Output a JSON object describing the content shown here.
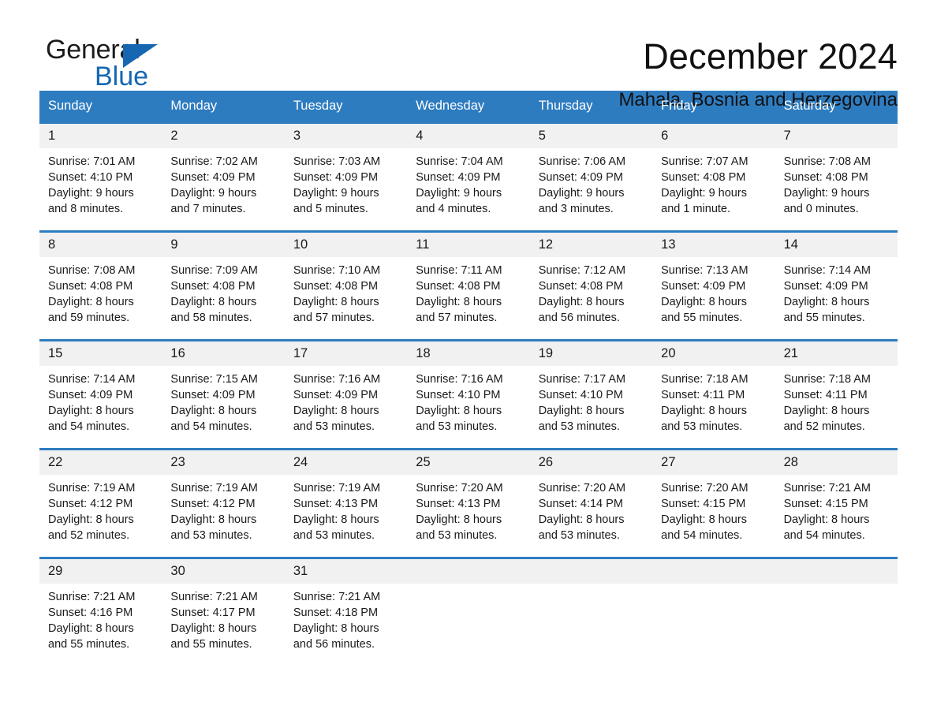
{
  "brand": {
    "name_part1": "General",
    "name_part2": "Blue",
    "triangle_icon": "blue-triangle-icon",
    "accent_color": "#1667b2"
  },
  "header": {
    "title": "December 2024",
    "location": "Mahala, Bosnia and Herzegovina"
  },
  "calendar": {
    "header_bg": "#2e7cc0",
    "daynum_bg": "#f1f1f1",
    "weekdays": [
      "Sunday",
      "Monday",
      "Tuesday",
      "Wednesday",
      "Thursday",
      "Friday",
      "Saturday"
    ],
    "weeks": [
      [
        {
          "day": "1",
          "sunrise": "Sunrise: 7:01 AM",
          "sunset": "Sunset: 4:10 PM",
          "daylight_line1": "Daylight: 9 hours",
          "daylight_line2": "and 8 minutes."
        },
        {
          "day": "2",
          "sunrise": "Sunrise: 7:02 AM",
          "sunset": "Sunset: 4:09 PM",
          "daylight_line1": "Daylight: 9 hours",
          "daylight_line2": "and 7 minutes."
        },
        {
          "day": "3",
          "sunrise": "Sunrise: 7:03 AM",
          "sunset": "Sunset: 4:09 PM",
          "daylight_line1": "Daylight: 9 hours",
          "daylight_line2": "and 5 minutes."
        },
        {
          "day": "4",
          "sunrise": "Sunrise: 7:04 AM",
          "sunset": "Sunset: 4:09 PM",
          "daylight_line1": "Daylight: 9 hours",
          "daylight_line2": "and 4 minutes."
        },
        {
          "day": "5",
          "sunrise": "Sunrise: 7:06 AM",
          "sunset": "Sunset: 4:09 PM",
          "daylight_line1": "Daylight: 9 hours",
          "daylight_line2": "and 3 minutes."
        },
        {
          "day": "6",
          "sunrise": "Sunrise: 7:07 AM",
          "sunset": "Sunset: 4:08 PM",
          "daylight_line1": "Daylight: 9 hours",
          "daylight_line2": "and 1 minute."
        },
        {
          "day": "7",
          "sunrise": "Sunrise: 7:08 AM",
          "sunset": "Sunset: 4:08 PM",
          "daylight_line1": "Daylight: 9 hours",
          "daylight_line2": "and 0 minutes."
        }
      ],
      [
        {
          "day": "8",
          "sunrise": "Sunrise: 7:08 AM",
          "sunset": "Sunset: 4:08 PM",
          "daylight_line1": "Daylight: 8 hours",
          "daylight_line2": "and 59 minutes."
        },
        {
          "day": "9",
          "sunrise": "Sunrise: 7:09 AM",
          "sunset": "Sunset: 4:08 PM",
          "daylight_line1": "Daylight: 8 hours",
          "daylight_line2": "and 58 minutes."
        },
        {
          "day": "10",
          "sunrise": "Sunrise: 7:10 AM",
          "sunset": "Sunset: 4:08 PM",
          "daylight_line1": "Daylight: 8 hours",
          "daylight_line2": "and 57 minutes."
        },
        {
          "day": "11",
          "sunrise": "Sunrise: 7:11 AM",
          "sunset": "Sunset: 4:08 PM",
          "daylight_line1": "Daylight: 8 hours",
          "daylight_line2": "and 57 minutes."
        },
        {
          "day": "12",
          "sunrise": "Sunrise: 7:12 AM",
          "sunset": "Sunset: 4:08 PM",
          "daylight_line1": "Daylight: 8 hours",
          "daylight_line2": "and 56 minutes."
        },
        {
          "day": "13",
          "sunrise": "Sunrise: 7:13 AM",
          "sunset": "Sunset: 4:09 PM",
          "daylight_line1": "Daylight: 8 hours",
          "daylight_line2": "and 55 minutes."
        },
        {
          "day": "14",
          "sunrise": "Sunrise: 7:14 AM",
          "sunset": "Sunset: 4:09 PM",
          "daylight_line1": "Daylight: 8 hours",
          "daylight_line2": "and 55 minutes."
        }
      ],
      [
        {
          "day": "15",
          "sunrise": "Sunrise: 7:14 AM",
          "sunset": "Sunset: 4:09 PM",
          "daylight_line1": "Daylight: 8 hours",
          "daylight_line2": "and 54 minutes."
        },
        {
          "day": "16",
          "sunrise": "Sunrise: 7:15 AM",
          "sunset": "Sunset: 4:09 PM",
          "daylight_line1": "Daylight: 8 hours",
          "daylight_line2": "and 54 minutes."
        },
        {
          "day": "17",
          "sunrise": "Sunrise: 7:16 AM",
          "sunset": "Sunset: 4:09 PM",
          "daylight_line1": "Daylight: 8 hours",
          "daylight_line2": "and 53 minutes."
        },
        {
          "day": "18",
          "sunrise": "Sunrise: 7:16 AM",
          "sunset": "Sunset: 4:10 PM",
          "daylight_line1": "Daylight: 8 hours",
          "daylight_line2": "and 53 minutes."
        },
        {
          "day": "19",
          "sunrise": "Sunrise: 7:17 AM",
          "sunset": "Sunset: 4:10 PM",
          "daylight_line1": "Daylight: 8 hours",
          "daylight_line2": "and 53 minutes."
        },
        {
          "day": "20",
          "sunrise": "Sunrise: 7:18 AM",
          "sunset": "Sunset: 4:11 PM",
          "daylight_line1": "Daylight: 8 hours",
          "daylight_line2": "and 53 minutes."
        },
        {
          "day": "21",
          "sunrise": "Sunrise: 7:18 AM",
          "sunset": "Sunset: 4:11 PM",
          "daylight_line1": "Daylight: 8 hours",
          "daylight_line2": "and 52 minutes."
        }
      ],
      [
        {
          "day": "22",
          "sunrise": "Sunrise: 7:19 AM",
          "sunset": "Sunset: 4:12 PM",
          "daylight_line1": "Daylight: 8 hours",
          "daylight_line2": "and 52 minutes."
        },
        {
          "day": "23",
          "sunrise": "Sunrise: 7:19 AM",
          "sunset": "Sunset: 4:12 PM",
          "daylight_line1": "Daylight: 8 hours",
          "daylight_line2": "and 53 minutes."
        },
        {
          "day": "24",
          "sunrise": "Sunrise: 7:19 AM",
          "sunset": "Sunset: 4:13 PM",
          "daylight_line1": "Daylight: 8 hours",
          "daylight_line2": "and 53 minutes."
        },
        {
          "day": "25",
          "sunrise": "Sunrise: 7:20 AM",
          "sunset": "Sunset: 4:13 PM",
          "daylight_line1": "Daylight: 8 hours",
          "daylight_line2": "and 53 minutes."
        },
        {
          "day": "26",
          "sunrise": "Sunrise: 7:20 AM",
          "sunset": "Sunset: 4:14 PM",
          "daylight_line1": "Daylight: 8 hours",
          "daylight_line2": "and 53 minutes."
        },
        {
          "day": "27",
          "sunrise": "Sunrise: 7:20 AM",
          "sunset": "Sunset: 4:15 PM",
          "daylight_line1": "Daylight: 8 hours",
          "daylight_line2": "and 54 minutes."
        },
        {
          "day": "28",
          "sunrise": "Sunrise: 7:21 AM",
          "sunset": "Sunset: 4:15 PM",
          "daylight_line1": "Daylight: 8 hours",
          "daylight_line2": "and 54 minutes."
        }
      ],
      [
        {
          "day": "29",
          "sunrise": "Sunrise: 7:21 AM",
          "sunset": "Sunset: 4:16 PM",
          "daylight_line1": "Daylight: 8 hours",
          "daylight_line2": "and 55 minutes."
        },
        {
          "day": "30",
          "sunrise": "Sunrise: 7:21 AM",
          "sunset": "Sunset: 4:17 PM",
          "daylight_line1": "Daylight: 8 hours",
          "daylight_line2": "and 55 minutes."
        },
        {
          "day": "31",
          "sunrise": "Sunrise: 7:21 AM",
          "sunset": "Sunset: 4:18 PM",
          "daylight_line1": "Daylight: 8 hours",
          "daylight_line2": "and 56 minutes."
        },
        {
          "day": "",
          "sunrise": "",
          "sunset": "",
          "daylight_line1": "",
          "daylight_line2": ""
        },
        {
          "day": "",
          "sunrise": "",
          "sunset": "",
          "daylight_line1": "",
          "daylight_line2": ""
        },
        {
          "day": "",
          "sunrise": "",
          "sunset": "",
          "daylight_line1": "",
          "daylight_line2": ""
        },
        {
          "day": "",
          "sunrise": "",
          "sunset": "",
          "daylight_line1": "",
          "daylight_line2": ""
        }
      ]
    ]
  }
}
